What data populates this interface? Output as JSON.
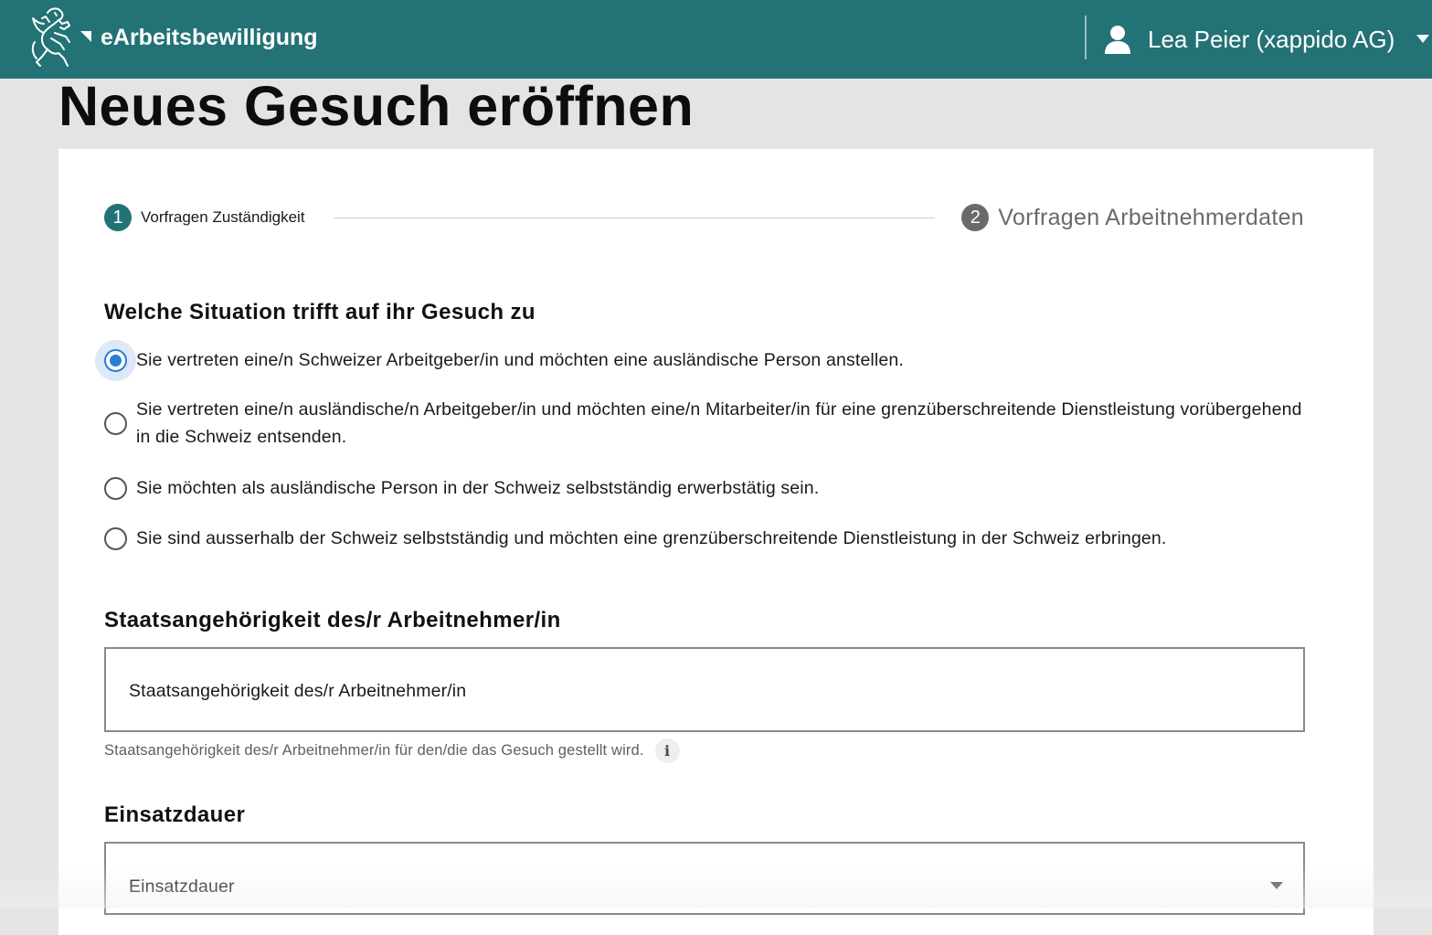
{
  "header": {
    "app_title": "eArbeitsbewilligung",
    "logo_icon": "zurich-lion-logo-icon",
    "user_icon": "user-icon",
    "user_name": "Lea Peier (xappido AG)",
    "caret_icon": "caret-down-icon",
    "background_color": "#237276"
  },
  "page": {
    "title": "Neues Gesuch eröffnen"
  },
  "stepper": {
    "steps": [
      {
        "number": "1",
        "label": "Vorfragen Zuständigkeit",
        "state": "active"
      },
      {
        "number": "2",
        "label": "Vorfragen Arbeitnehmerdaten",
        "state": "inactive"
      }
    ]
  },
  "situation": {
    "heading": "Welche Situation trifft auf ihr Gesuch zu",
    "options": [
      {
        "label": "Sie vertreten eine/n Schweizer Arbeitgeber/in und möchten eine ausländische Person anstellen.",
        "selected": true
      },
      {
        "label": "Sie vertreten eine/n ausländische/n Arbeitgeber/in und möchten eine/n Mitarbeiter/in für eine grenzüberschreitende Dienstleistung vorübergehend in die Schweiz entsenden.",
        "selected": false
      },
      {
        "label": "Sie möchten als ausländische Person in der Schweiz selbstständig erwerbstätig sein.",
        "selected": false
      },
      {
        "label": "Sie sind ausserhalb der Schweiz selbstständig und möchten eine grenzüberschreitende Dienstleistung in der Schweiz erbringen.",
        "selected": false
      }
    ],
    "selected_color": "#2a7fd4"
  },
  "nationality": {
    "heading": "Staatsangehörigkeit des/r Arbeitnehmer/in",
    "placeholder": "Staatsangehörigkeit des/r Arbeitnehmer/in",
    "helper_text": "Staatsangehörigkeit des/r Arbeitnehmer/in für den/die das Gesuch gestellt wird.",
    "info_icon": "info-icon",
    "info_glyph": "i"
  },
  "duration": {
    "heading": "Einsatzdauer",
    "placeholder": "Einsatzdauer",
    "caret_icon": "chevron-down-icon"
  }
}
